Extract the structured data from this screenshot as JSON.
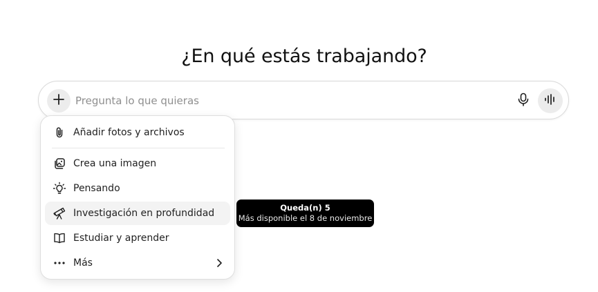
{
  "heading": "¿En qué estás trabajando?",
  "composer": {
    "placeholder": "Pregunta lo que quieras",
    "value": "",
    "icons": {
      "add": "plus-icon",
      "dictate": "microphone-icon",
      "voice": "voice-waveform-icon"
    }
  },
  "menu": {
    "items": [
      {
        "label": "Añadir fotos y archivos",
        "icon": "paperclip-icon"
      },
      {
        "label": "Crea una imagen",
        "icon": "image-icon"
      },
      {
        "label": "Pensando",
        "icon": "lightbulb-icon"
      },
      {
        "label": "Investigación en profundidad",
        "icon": "telescope-icon",
        "highlighted": true
      },
      {
        "label": "Estudiar y aprender",
        "icon": "book-icon"
      },
      {
        "label": "Más",
        "icon": "more-dots-icon",
        "submenu": true
      }
    ]
  },
  "tooltip": {
    "title": "Queda(n) 5",
    "subtitle": "Más disponible el 8 de noviembre"
  },
  "colors": {
    "text": "#0d0d0d",
    "placeholder": "#8f8f8f",
    "button_bg": "#ececec",
    "hover_bg": "#f3f3f3",
    "tooltip_bg": "#000000"
  }
}
